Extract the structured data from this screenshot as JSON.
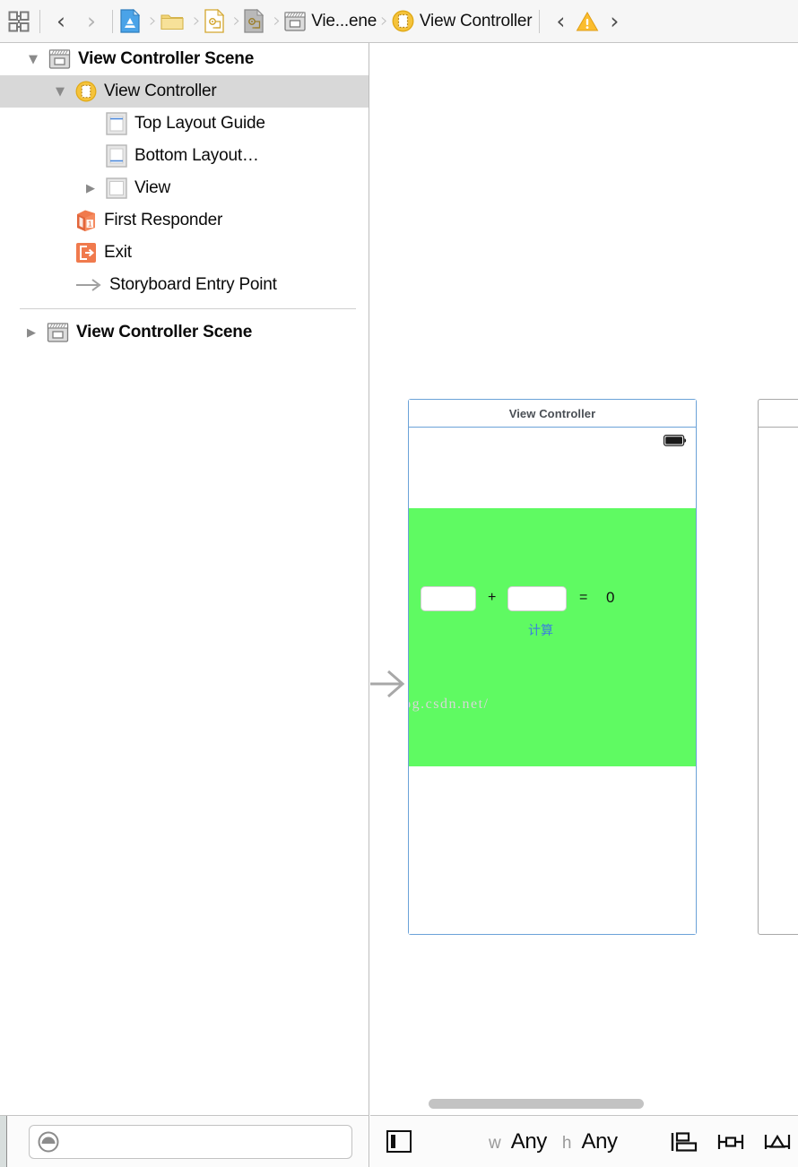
{
  "jumpbar": {
    "related_items_icon": "grid-icon",
    "back_label": "‹",
    "forward_label": "›",
    "crumbs": [
      {
        "icon": "xcode-project-icon",
        "label": ""
      },
      {
        "icon": "folder-icon",
        "label": ""
      },
      {
        "icon": "storyboard-doc-icon",
        "label": ""
      },
      {
        "icon": "storyboard-doc-gray-icon",
        "label": ""
      },
      {
        "icon": "scene-icon",
        "label": "Vie...ene"
      },
      {
        "icon": "view-controller-icon",
        "label": "View Controller"
      }
    ],
    "issue_prev_label": "‹",
    "issue_next_label": "›",
    "warning_icon": "warning-triangle-icon"
  },
  "outline": {
    "rows": [
      {
        "label": "View Controller Scene",
        "icon": "scene-icon",
        "indent": 0,
        "twisty": "down",
        "bold": true,
        "selected": false
      },
      {
        "label": "View Controller",
        "icon": "view-controller-icon",
        "indent": 1,
        "twisty": "down",
        "bold": false,
        "selected": true
      },
      {
        "label": "Top Layout Guide",
        "icon": "top-layout-guide-icon",
        "indent": 2,
        "twisty": "none",
        "bold": false,
        "selected": false
      },
      {
        "label": "Bottom Layout…",
        "icon": "bottom-layout-guide-icon",
        "indent": 2,
        "twisty": "none",
        "bold": false,
        "selected": false
      },
      {
        "label": "View",
        "icon": "view-icon",
        "indent": 2,
        "twisty": "right",
        "bold": false,
        "selected": false
      },
      {
        "label": "First Responder",
        "icon": "first-responder-icon",
        "indent": 1,
        "twisty": "none",
        "bold": false,
        "selected": false
      },
      {
        "label": "Exit",
        "icon": "exit-icon",
        "indent": 1,
        "twisty": "none",
        "bold": false,
        "selected": false
      },
      {
        "label": "Storyboard Entry Point",
        "icon": "entry-point-arrow-icon",
        "indent": 1,
        "twisty": "none",
        "bold": false,
        "selected": false
      }
    ],
    "second_scene": {
      "label": "View Controller Scene",
      "icon": "scene-icon",
      "twisty": "right",
      "bold": true
    }
  },
  "filter": {
    "icon": "filter-circle-icon",
    "value": "",
    "placeholder": ""
  },
  "canvas": {
    "scene": {
      "title": "View Controller",
      "status_bar_icon": "battery-icon",
      "background_color": "#5ffa62",
      "field_1_value": "",
      "field_1_placeholder": "",
      "field_2_value": "",
      "field_2_placeholder": "",
      "plus_symbol": "+",
      "equals_symbol": "=",
      "result_value": "0",
      "button_label": "计算",
      "button_color": "#3b7de0"
    },
    "entry_point_icon": "entry-point-arrow-icon",
    "watermark": "http://blog.csdn.net/"
  },
  "canvasbar": {
    "document_outline_toggle_icon": "document-outline-toggle-icon",
    "size_class": {
      "width_prefix": "w",
      "width_value": "Any",
      "height_prefix": "h",
      "height_value": "Any"
    },
    "align_icon": "align-icon",
    "pin_icon": "pin-icon",
    "resolve_icon": "resolve-issues-icon"
  }
}
